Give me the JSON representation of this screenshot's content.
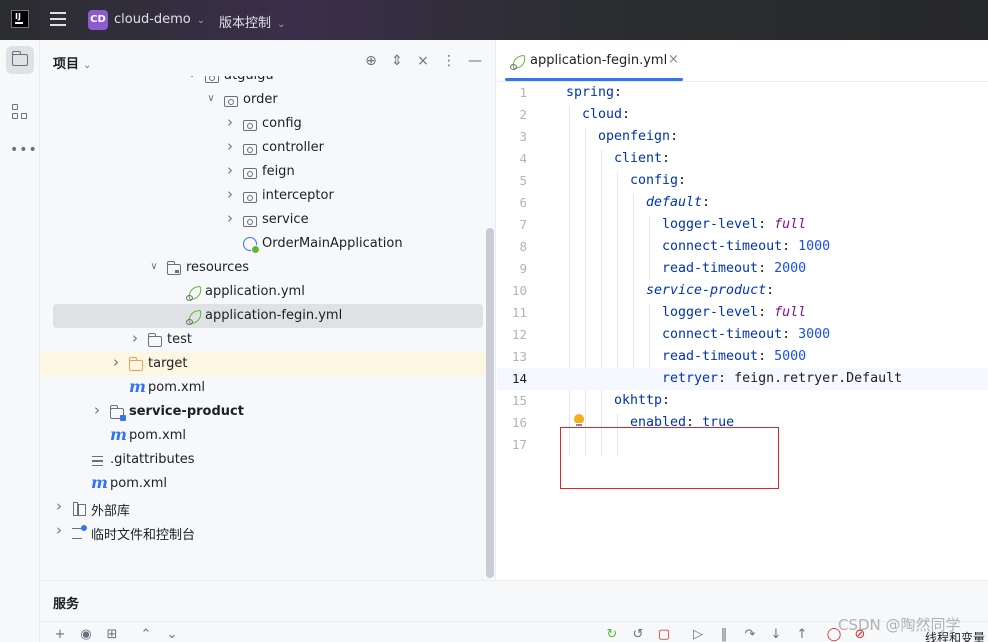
{
  "titlebar": {
    "logo_text": "IJ",
    "project_badge": "CD",
    "project_name": "cloud-demo",
    "vcs_label": "版本控制"
  },
  "project_panel": {
    "title": "项目",
    "tree": [
      {
        "label": "atguigu",
        "depth": 7,
        "expanded": true,
        "icon": "package-icon"
      },
      {
        "label": "order",
        "depth": 8,
        "expanded": true,
        "icon": "package-icon"
      },
      {
        "label": "config",
        "depth": 9,
        "expanded": false,
        "icon": "package-icon"
      },
      {
        "label": "controller",
        "depth": 9,
        "expanded": false,
        "icon": "package-icon"
      },
      {
        "label": "feign",
        "depth": 9,
        "expanded": false,
        "icon": "package-icon"
      },
      {
        "label": "interceptor",
        "depth": 9,
        "expanded": false,
        "icon": "package-icon"
      },
      {
        "label": "service",
        "depth": 9,
        "expanded": false,
        "icon": "package-icon"
      },
      {
        "label": "OrderMainApplication",
        "depth": 9,
        "icon": "spring-app-icon"
      },
      {
        "label": "resources",
        "depth": 5,
        "expanded": true,
        "icon": "resources-folder-icon"
      },
      {
        "label": "application.yml",
        "depth": 6,
        "icon": "spring-leaf-icon"
      },
      {
        "label": "application-fegin.yml",
        "depth": 6,
        "icon": "spring-leaf-icon",
        "selected": true
      },
      {
        "label": "test",
        "depth": 4,
        "expanded": false,
        "icon": "folder-icon"
      },
      {
        "label": "target",
        "depth": 3,
        "expanded": false,
        "icon": "orange-folder-icon",
        "highlight": true
      },
      {
        "label": "pom.xml",
        "depth": 3,
        "icon": "maven-icon"
      },
      {
        "label": "service-product",
        "depth": 2,
        "expanded": false,
        "icon": "module-folder-icon",
        "bold": true
      },
      {
        "label": "pom.xml",
        "depth": 2,
        "icon": "maven-icon"
      },
      {
        "label": ".gitattributes",
        "depth": 1,
        "icon": "text-file-icon"
      },
      {
        "label": "pom.xml",
        "depth": 1,
        "icon": "maven-icon"
      },
      {
        "label": "外部库",
        "depth": 0,
        "expanded": false,
        "icon": "library-icon"
      },
      {
        "label": "临时文件和控制台",
        "depth": 0,
        "expanded": false,
        "icon": "scratch-icon"
      }
    ]
  },
  "editor": {
    "tab_title": "application-fegin.yml",
    "current_line": 14,
    "lines": [
      {
        "num": "1",
        "indent": 0,
        "parts": [
          {
            "t": "spring",
            "c": "k"
          },
          {
            "t": ":",
            "c": "p"
          }
        ]
      },
      {
        "num": "2",
        "indent": 1,
        "parts": [
          {
            "t": "cloud",
            "c": "k"
          },
          {
            "t": ":",
            "c": "p"
          }
        ]
      },
      {
        "num": "3",
        "indent": 2,
        "parts": [
          {
            "t": "openfeign",
            "c": "k"
          },
          {
            "t": ":",
            "c": "p"
          }
        ]
      },
      {
        "num": "4",
        "indent": 3,
        "parts": [
          {
            "t": "client",
            "c": "k"
          },
          {
            "t": ":",
            "c": "p"
          }
        ]
      },
      {
        "num": "5",
        "indent": 4,
        "parts": [
          {
            "t": "config",
            "c": "k"
          },
          {
            "t": ":",
            "c": "p"
          }
        ]
      },
      {
        "num": "6",
        "indent": 5,
        "parts": [
          {
            "t": "default",
            "c": "it"
          },
          {
            "t": ":",
            "c": "p"
          }
        ]
      },
      {
        "num": "7",
        "indent": 6,
        "parts": [
          {
            "t": "logger-level",
            "c": "k"
          },
          {
            "t": ": ",
            "c": "p"
          },
          {
            "t": "full",
            "c": "kw"
          }
        ]
      },
      {
        "num": "8",
        "indent": 6,
        "parts": [
          {
            "t": "connect-timeout",
            "c": "k"
          },
          {
            "t": ": ",
            "c": "p"
          },
          {
            "t": "1000",
            "c": "n"
          }
        ]
      },
      {
        "num": "9",
        "indent": 6,
        "parts": [
          {
            "t": "read-timeout",
            "c": "k"
          },
          {
            "t": ": ",
            "c": "p"
          },
          {
            "t": "2000",
            "c": "n"
          }
        ]
      },
      {
        "num": "10",
        "indent": 5,
        "parts": [
          {
            "t": "service-product",
            "c": "it"
          },
          {
            "t": ":",
            "c": "p"
          }
        ]
      },
      {
        "num": "11",
        "indent": 6,
        "parts": [
          {
            "t": "logger-level",
            "c": "k"
          },
          {
            "t": ": ",
            "c": "p"
          },
          {
            "t": "full",
            "c": "kw"
          }
        ]
      },
      {
        "num": "12",
        "indent": 6,
        "parts": [
          {
            "t": "connect-timeout",
            "c": "k"
          },
          {
            "t": ": ",
            "c": "p"
          },
          {
            "t": "3000",
            "c": "n"
          }
        ]
      },
      {
        "num": "13",
        "indent": 6,
        "parts": [
          {
            "t": "read-timeout",
            "c": "k"
          },
          {
            "t": ": ",
            "c": "p"
          },
          {
            "t": "5000",
            "c": "n"
          }
        ]
      },
      {
        "num": "14",
        "indent": 6,
        "parts": [
          {
            "t": "retryer",
            "c": "k"
          },
          {
            "t": ": ",
            "c": "p"
          },
          {
            "t": "feign.retryer.Default",
            "c": "p"
          }
        ]
      },
      {
        "num": "15",
        "indent": 3,
        "parts": [
          {
            "t": "okhttp",
            "c": "k"
          },
          {
            "t": ":",
            "c": "p"
          }
        ]
      },
      {
        "num": "16",
        "indent": 4,
        "parts": [
          {
            "t": "enabled",
            "c": "k"
          },
          {
            "t": ": ",
            "c": "p"
          },
          {
            "t": "true",
            "c": "k"
          }
        ]
      },
      {
        "num": "17",
        "indent": 0,
        "parts": []
      }
    ]
  },
  "bottom_panel": {
    "title": "服务",
    "right_label": "线程和变量"
  },
  "watermark": "CSDN @陶然同学",
  "colors": {
    "accent": "#3574f0",
    "highlight_box": "#e0242b",
    "yaml_key": "#0033b3",
    "yaml_number": "#1750eb"
  }
}
